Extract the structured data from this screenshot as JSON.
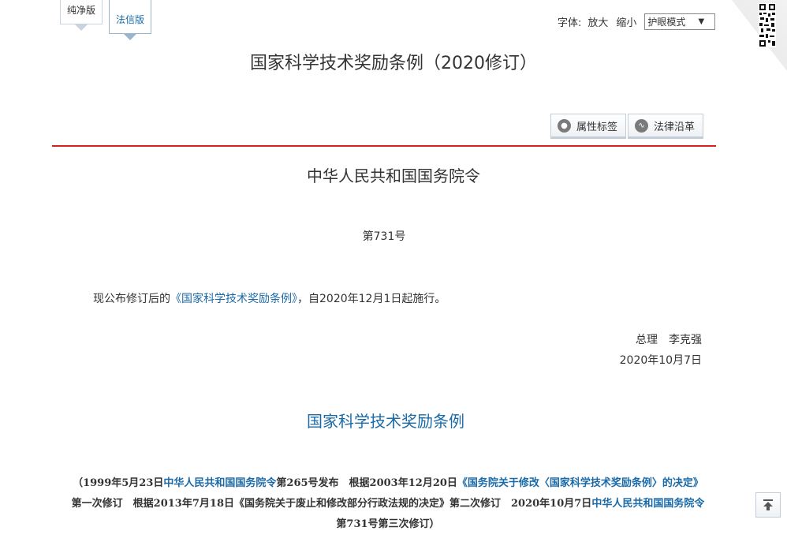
{
  "tabs": {
    "pure": "纯净版",
    "legal": "法信版"
  },
  "font_tools": {
    "label": "字体:",
    "enlarge": "放大",
    "shrink": "缩小",
    "mode": "护眼模式"
  },
  "doc_title": "国家科学技术奖励条例（2020修订）",
  "meta_buttons": {
    "tags": "属性标签",
    "history": "法律沿革"
  },
  "order": {
    "title": "中华人民共和国国务院令",
    "number": "第731号",
    "text_before": "现公布修订后的",
    "link": "《国家科学技术奖励条例》",
    "text_after": "，自2020年12月1日起施行。",
    "signer": "总理　李克强",
    "date": "2020年10月7日"
  },
  "law_title": "国家科学技术奖励条例",
  "history": {
    "p1": "（1999年5月23日",
    "l1": "中华人民共和国国务院令",
    "p2": "第265号发布　根据2003年12月20日",
    "l2": "《国务院关于修改〈国家科学技术奖励条例〉的决定》",
    "p3": "第一次修订　根据2013年7月18日《国务院关于废止和修改部分行政法规的决定》第二次修订　2020年10月7日",
    "l3": "中华人民共和国国务院令",
    "p4": "第731号第三次修订）"
  },
  "colors": {
    "rule": "#d71f26",
    "link": "#1a6aa8"
  },
  "icons": {
    "tags": "tag-icon",
    "history": "trend-icon",
    "top": "back-to-top-icon",
    "qr": "qr-code-icon"
  }
}
